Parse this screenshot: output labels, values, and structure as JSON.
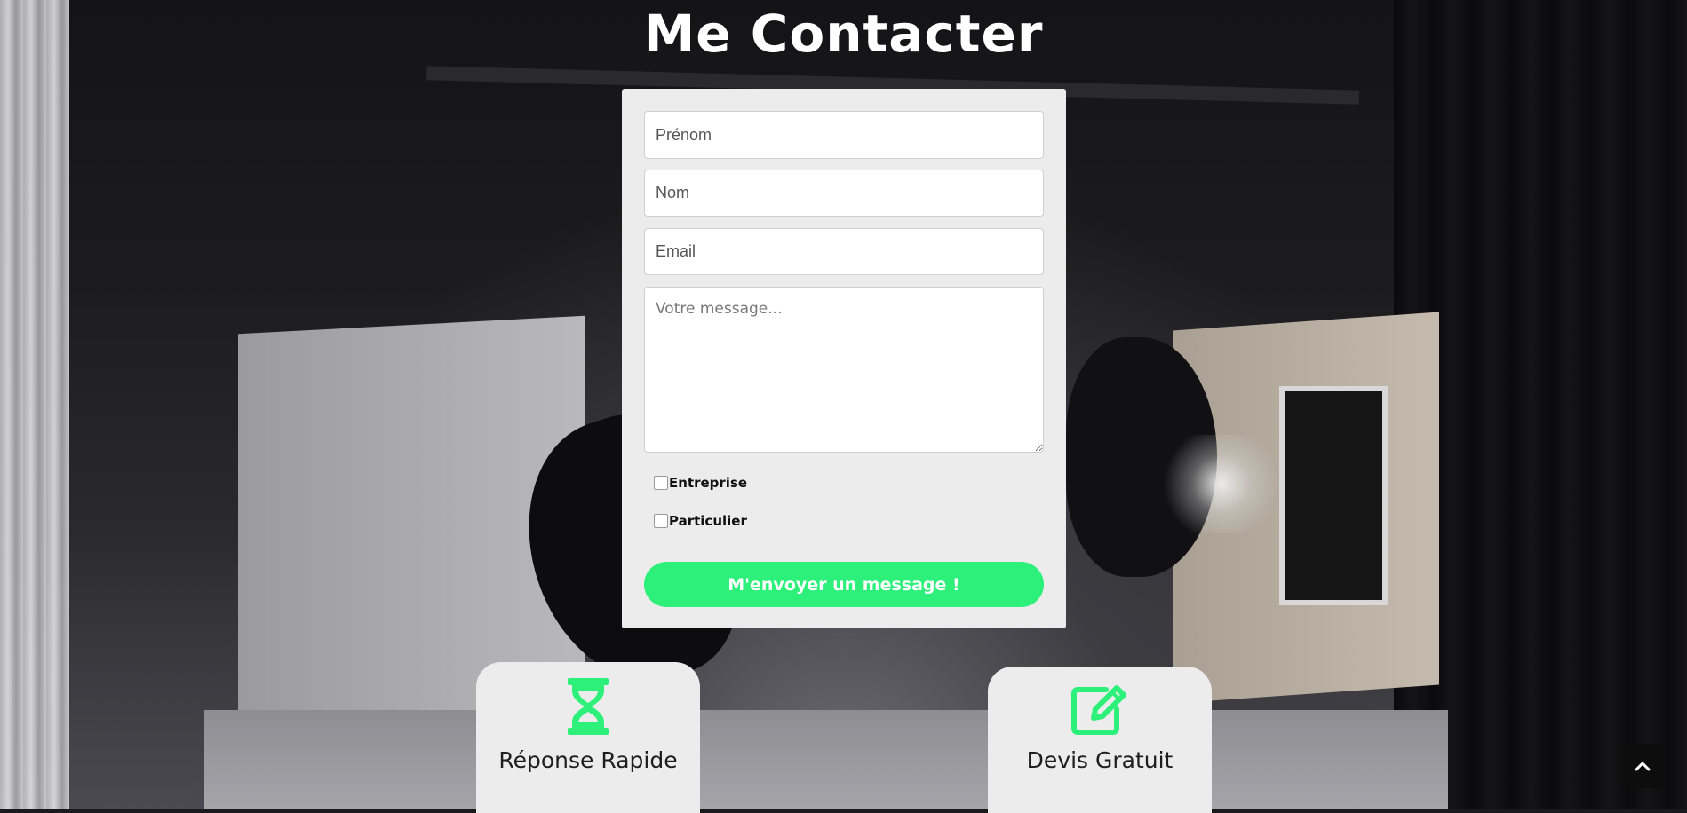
{
  "page": {
    "title": "Me Contacter"
  },
  "form": {
    "first_name_placeholder": "Prénom",
    "last_name_placeholder": "Nom",
    "email_placeholder": "Email",
    "message_placeholder": "Votre message...",
    "checkbox_company_label": "Entreprise",
    "checkbox_individual_label": "Particulier",
    "submit_label": "M'envoyer un message !"
  },
  "features": [
    {
      "icon": "hourglass-icon",
      "label": "Réponse Rapide"
    },
    {
      "icon": "edit-icon",
      "label": "Devis Gratuit"
    }
  ],
  "scroll_top": {
    "icon": "chevron-up-icon"
  },
  "colors": {
    "accent": "#2cf07a",
    "card_background": "#ececec",
    "title": "#ffffff"
  }
}
